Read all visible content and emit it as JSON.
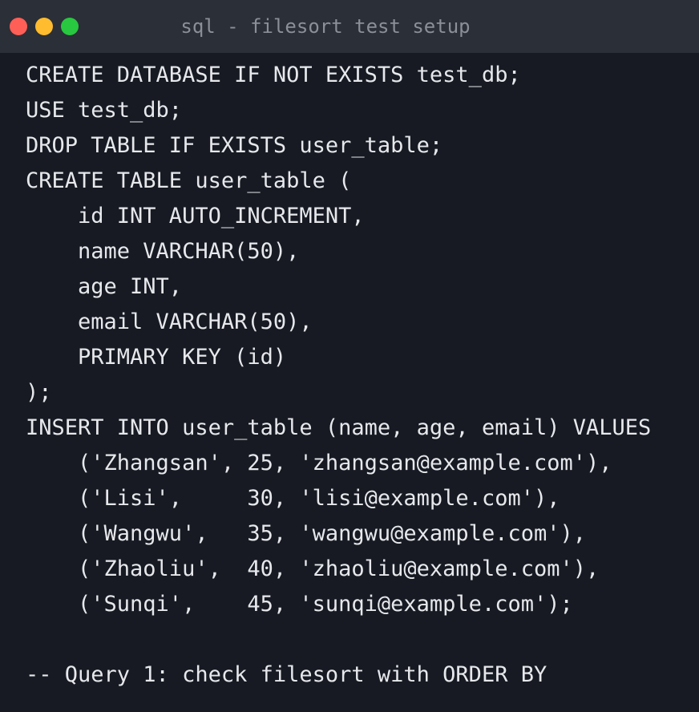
{
  "window": {
    "title": "sql - filesort test setup",
    "buttons": {
      "close_color": "#ff5f57",
      "minimize_color": "#febc2e",
      "maximize_color": "#28c840"
    }
  },
  "code": {
    "lines": [
      "CREATE DATABASE IF NOT EXISTS test_db;",
      "USE test_db;",
      "DROP TABLE IF EXISTS user_table;",
      "CREATE TABLE user_table (",
      "    id INT AUTO_INCREMENT,",
      "    name VARCHAR(50),",
      "    age INT,",
      "    email VARCHAR(50),",
      "    PRIMARY KEY (id)",
      ");",
      "INSERT INTO user_table (name, age, email) VALUES",
      "    ('Zhangsan', 25, 'zhangsan@example.com'),",
      "    ('Lisi',     30, 'lisi@example.com'),",
      "    ('Wangwu',   35, 'wangwu@example.com'),",
      "    ('Zhaoliu',  40, 'zhaoliu@example.com'),",
      "    ('Sunqi',    45, 'sunqi@example.com');",
      "",
      "-- Query 1: check filesort with ORDER BY"
    ]
  },
  "colors": {
    "titlebar": "#2b2f37",
    "background": "#171a22",
    "text": "#e6e8ec",
    "title_text": "#8a8f98"
  }
}
